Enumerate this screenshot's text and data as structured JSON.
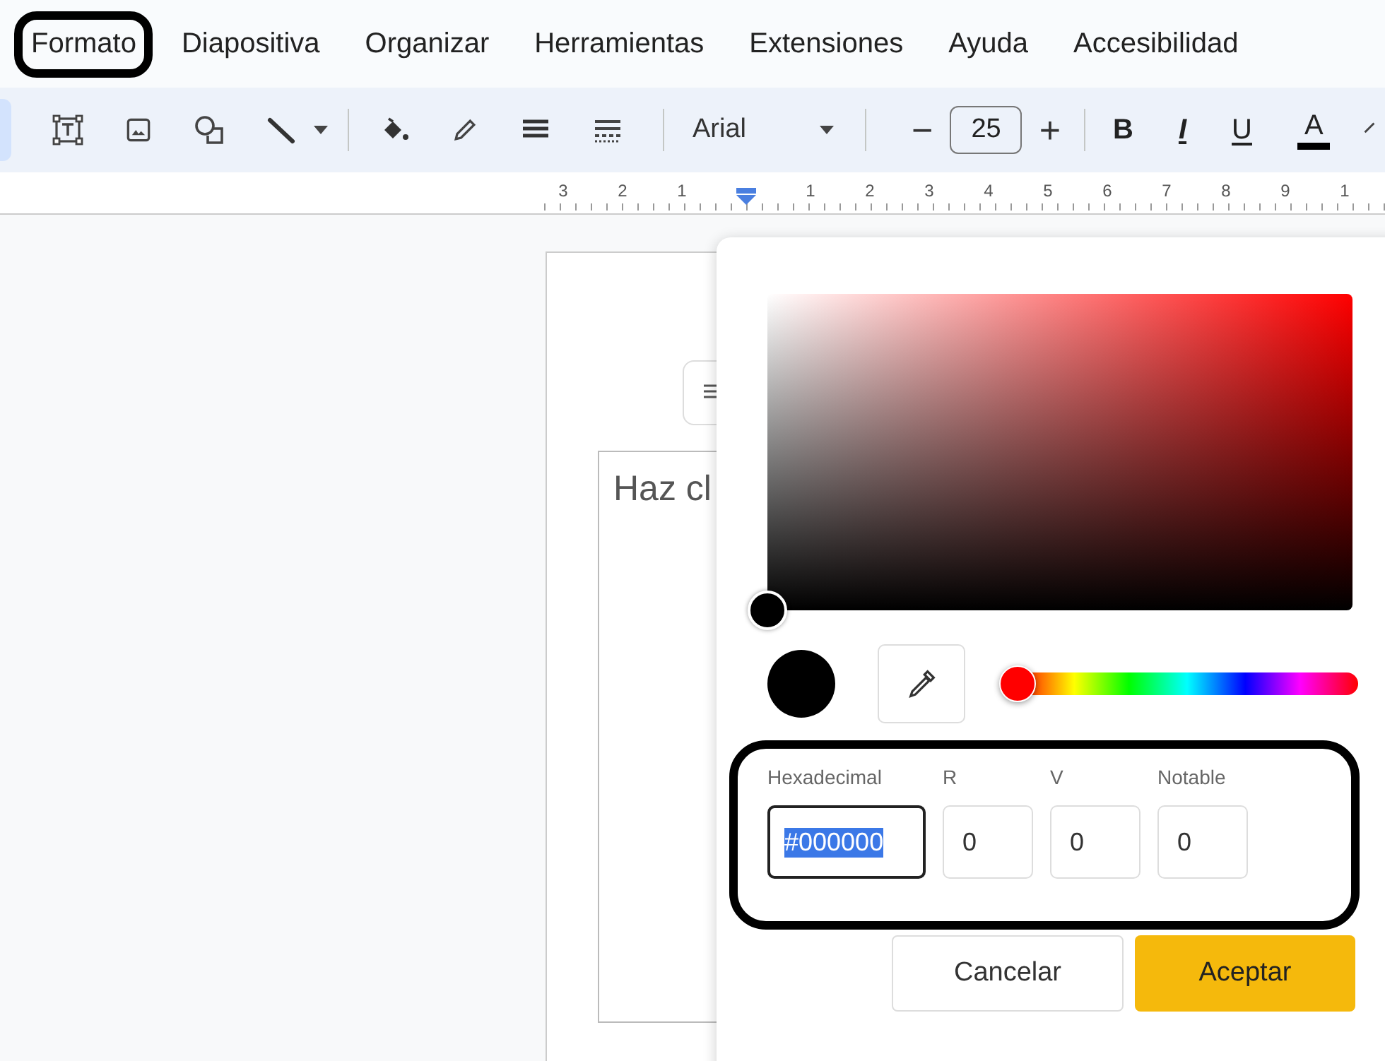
{
  "menu_bar": {
    "items": [
      {
        "label": "Formato",
        "highlighted": true
      },
      {
        "label": "Diapositiva",
        "highlighted": false
      },
      {
        "label": "Organizar",
        "highlighted": false
      },
      {
        "label": "Herramientas",
        "highlighted": false
      },
      {
        "label": "Extensiones",
        "highlighted": false
      },
      {
        "label": "Ayuda",
        "highlighted": false
      },
      {
        "label": "Accesibilidad",
        "highlighted": false
      }
    ]
  },
  "toolbar": {
    "font": "Arial",
    "font_size": "25",
    "decrease": "−",
    "increase": "+",
    "format_buttons": [
      {
        "label": "B",
        "kind": "bold"
      },
      {
        "label": "I",
        "kind": "italic"
      },
      {
        "label": "U",
        "kind": "underline"
      },
      {
        "label": "A",
        "kind": "color"
      }
    ]
  },
  "ruler": {
    "left_labels": [
      "3",
      "2",
      "1"
    ],
    "right_labels": [
      "1",
      "2",
      "3",
      "4",
      "5",
      "6",
      "7",
      "8",
      "9",
      "1"
    ]
  },
  "slide": {
    "text_box": "Haz cl"
  },
  "color_picker": {
    "hue_slider": {
      "level": 0
    },
    "fields_highlighted": true,
    "fields": [
      {
        "label": "Hexadecimal",
        "value": "#000000",
        "kind": "hex",
        "text_selected": true
      },
      {
        "label": "R",
        "value": "0",
        "kind": "number",
        "text_selected": false
      },
      {
        "label": "V",
        "value": "0",
        "kind": "number",
        "text_selected": false
      },
      {
        "label": "Notable",
        "value": "0",
        "kind": "number",
        "text_selected": false
      }
    ],
    "buttons": [
      {
        "label": "Cancelar",
        "kind": "secondary"
      },
      {
        "label": "Aceptar",
        "kind": "primary"
      }
    ]
  }
}
